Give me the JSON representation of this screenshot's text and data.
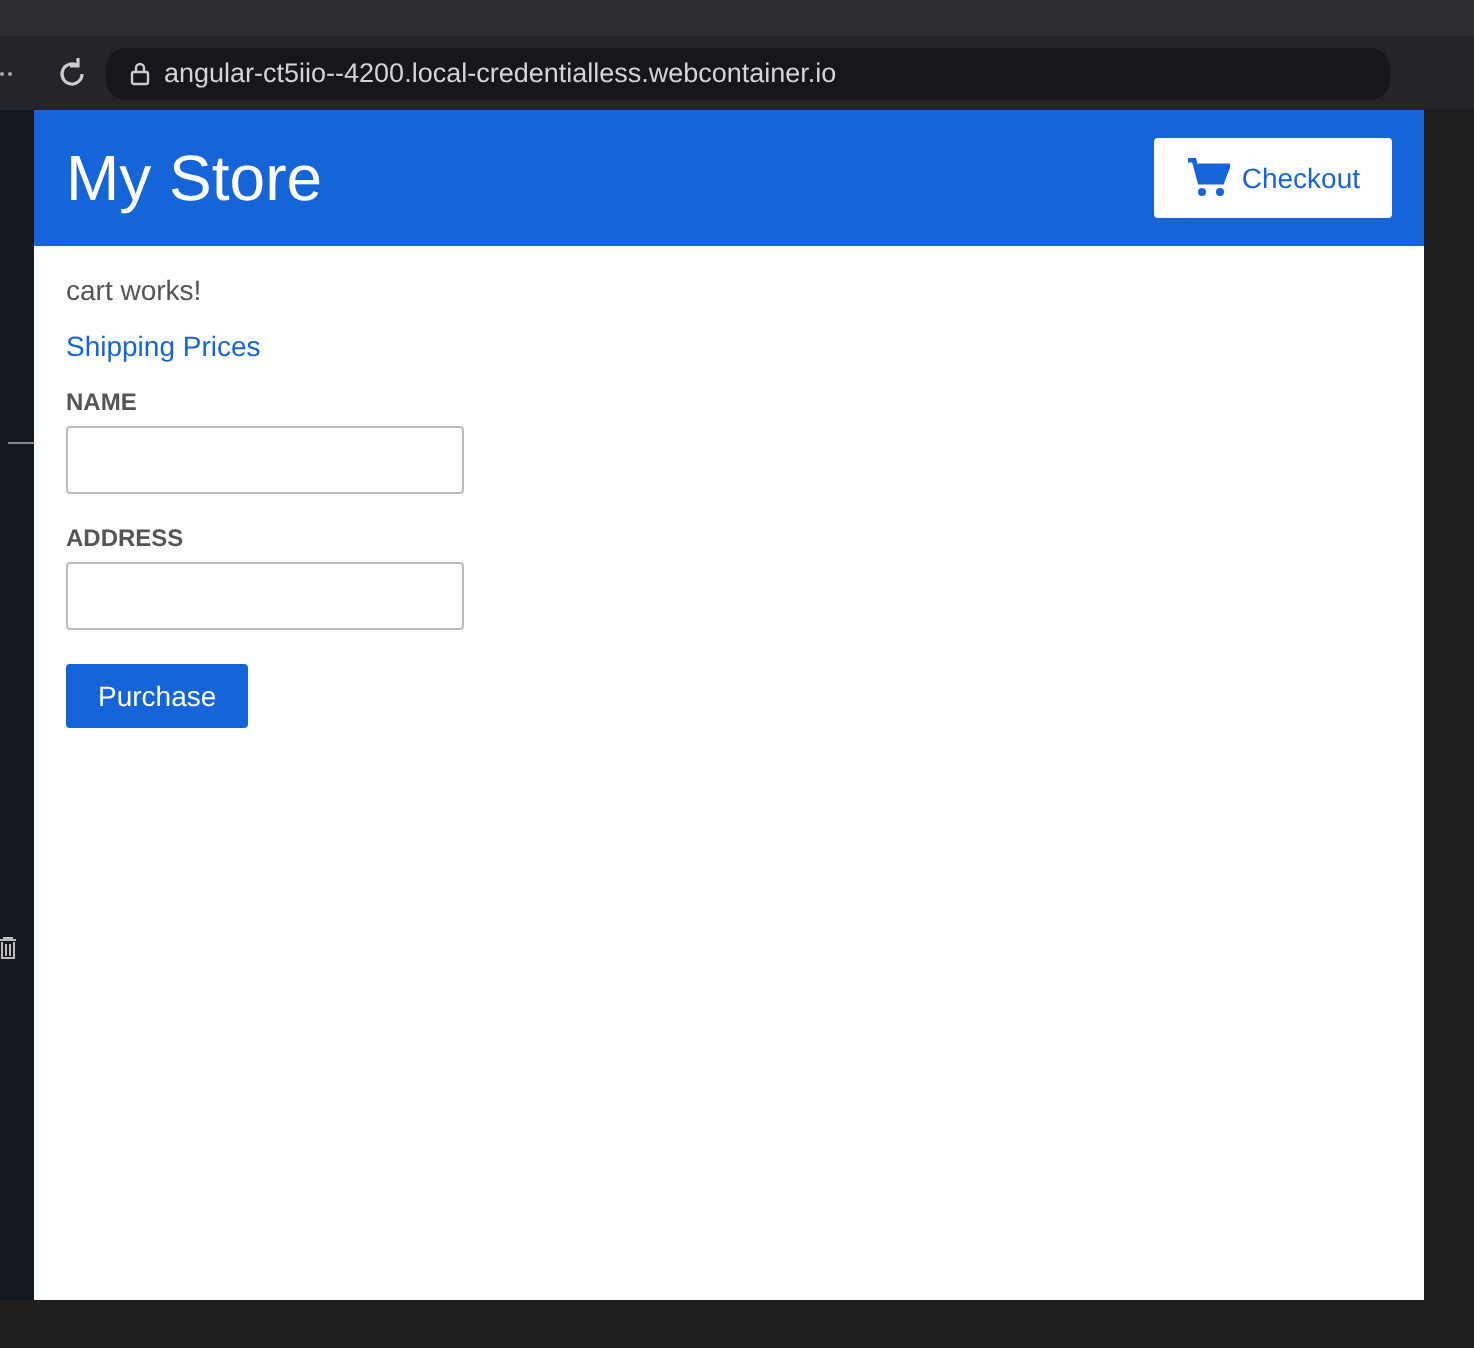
{
  "browser": {
    "url": "angular-ct5iio--4200.local-credentialless.webcontainer.io"
  },
  "top_bar": {
    "title": "My Store",
    "checkout_button": "Checkout"
  },
  "cart": {
    "message": "cart works!",
    "link": "Shipping Prices",
    "fields": [
      {
        "label": "NAME"
      },
      {
        "label": "ADDRESS"
      }
    ],
    "submit_button": "Purchase"
  }
}
